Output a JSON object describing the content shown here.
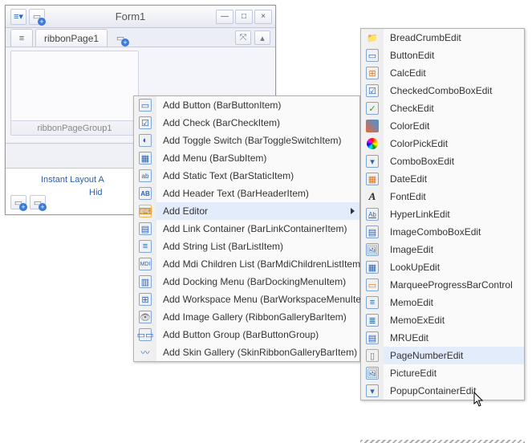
{
  "form": {
    "title": "Form1",
    "ribbon_tab_label": "ribbonPage1",
    "group_label": "ribbonPageGroup1",
    "link_layout": "Instant Layout A",
    "link_hide": "Hid"
  },
  "context_menu": {
    "items": [
      "Add Button (BarButtonItem)",
      "Add Check (BarCheckItem)",
      "Add Toggle Switch (BarToggleSwitchItem)",
      "Add Menu (BarSubItem)",
      "Add Static Text (BarStaticItem)",
      "Add Header Text (BarHeaderItem)",
      "Add Editor",
      "Add Link Container (BarLinkContainerItem)",
      "Add String List (BarListItem)",
      "Add Mdi Children List (BarMdiChildrenListItem)",
      "Add Docking Menu (BarDockingMenuItem)",
      "Add Workspace Menu (BarWorkspaceMenuItem)",
      "Add Image Gallery (RibbonGalleryBarItem)",
      "Add Button Group (BarButtonGroup)",
      "Add Skin Gallery (SkinRibbonGalleryBarItem)"
    ]
  },
  "editor_menu": {
    "items": [
      "BreadCrumbEdit",
      "ButtonEdit",
      "CalcEdit",
      "CheckedComboBoxEdit",
      "CheckEdit",
      "ColorEdit",
      "ColorPickEdit",
      "ComboBoxEdit",
      "DateEdit",
      "FontEdit",
      "HyperLinkEdit",
      "ImageComboBoxEdit",
      "ImageEdit",
      "LookUpEdit",
      "MarqueeProgressBarControl",
      "MemoEdit",
      "MemoExEdit",
      "MRUEdit",
      "PageNumberEdit",
      "PictureEdit",
      "PopupContainerEdit"
    ]
  }
}
